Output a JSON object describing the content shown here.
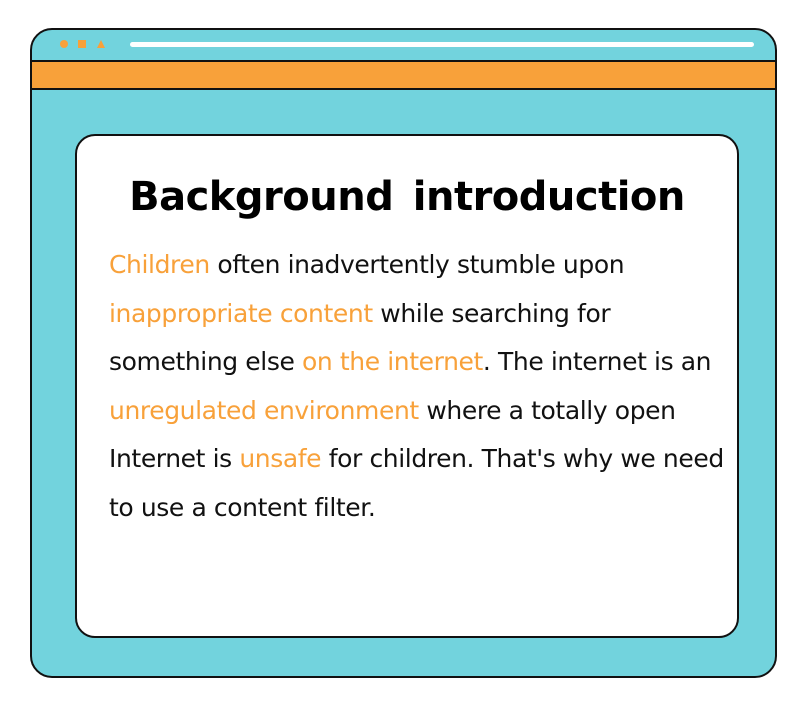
{
  "window": {
    "controls": [
      "dot-icon",
      "square-icon",
      "triangle-icon"
    ]
  },
  "card": {
    "title": "Background  introduction",
    "paragraph": [
      {
        "text": "Children",
        "highlight": true
      },
      {
        "text": " often inadvertently stumble upon ",
        "highlight": false
      },
      {
        "text": "inappropriate content",
        "highlight": true
      },
      {
        "text": " while searching for something else ",
        "highlight": false
      },
      {
        "text": "on the internet",
        "highlight": true
      },
      {
        "text": ". The internet is an ",
        "highlight": false
      },
      {
        "text": "unregulated environment",
        "highlight": true
      },
      {
        "text": " where a totally open Internet is ",
        "highlight": false
      },
      {
        "text": "unsafe",
        "highlight": true
      },
      {
        "text": " for children. That's why we need to use a content filter.",
        "highlight": false
      }
    ]
  },
  "colors": {
    "window_bg": "#72d3dd",
    "accent": "#f8a13a",
    "border": "#111111",
    "card_bg": "#ffffff"
  }
}
